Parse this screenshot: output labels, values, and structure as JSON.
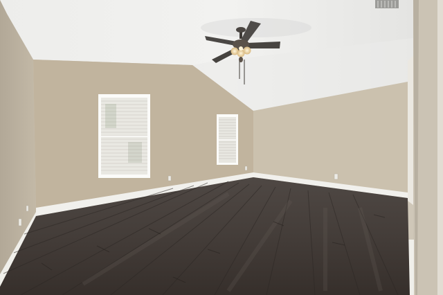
{
  "scene": {
    "kind": "empty-room-photo",
    "features": [
      "vaulted-ceiling",
      "ceiling-fan",
      "two-windows-with-blinds",
      "dark-wood-floor",
      "white-baseboards",
      "wall-outlets",
      "ceiling-vent",
      "doorway"
    ]
  },
  "colors": {
    "ceiling": "#efefed",
    "ceiling_shade": "#dcdcda",
    "wall_left": "#bdb3a2",
    "wall_back_left": "#c2b59f",
    "wall_back_right": "#cbc2b0",
    "wall_right_panel": "#c9c1b3",
    "door_frame": "#e9e6df",
    "baseboard": "#f1f0ec",
    "floor_dark": "#3a3532",
    "floor_mid": "#4c4541",
    "floor_light": "#5c5550",
    "blind": "#f4f3ef",
    "window_frame": "#fbfbf9",
    "fan_blade": "#4a4845",
    "fan_light": "#f6e7c5"
  }
}
